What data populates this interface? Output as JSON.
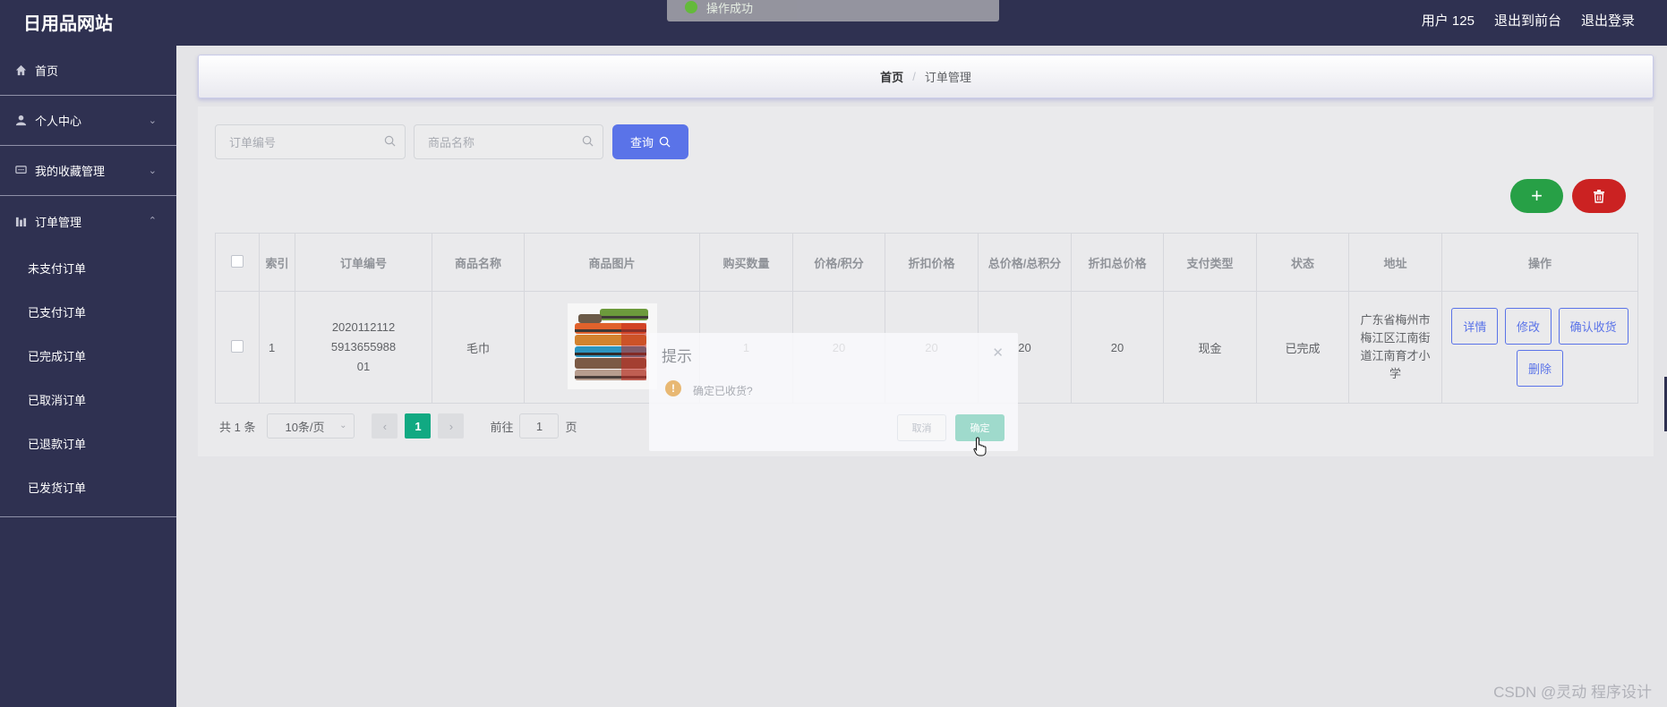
{
  "header": {
    "brand": "日用品网站",
    "user": "用户 125",
    "front_link": "退出到前台",
    "logout_link": "退出登录",
    "toast": "操作成功"
  },
  "sidebar": {
    "items": [
      {
        "label": "首页",
        "icon": "home-icon"
      },
      {
        "label": "个人中心",
        "icon": "user-icon"
      },
      {
        "label": "我的收藏管理",
        "icon": "chat-icon"
      },
      {
        "label": "订单管理",
        "icon": "chart-icon"
      }
    ],
    "subitems": [
      "未支付订单",
      "已支付订单",
      "已完成订单",
      "已取消订单",
      "已退款订单",
      "已发货订单"
    ]
  },
  "breadcrumb": {
    "home": "首页",
    "separator": "/",
    "current": "订单管理"
  },
  "search": {
    "order_no_placeholder": "订单编号",
    "product_placeholder": "商品名称",
    "query_label": "查询"
  },
  "table": {
    "headers": [
      "索引",
      "订单编号",
      "商品名称",
      "商品图片",
      "购买数量",
      "价格/积分",
      "折扣价格",
      "总价格/总积分",
      "折扣总价格",
      "支付类型",
      "状态",
      "地址",
      "操作"
    ],
    "rows": [
      {
        "index": "1",
        "order_no": "20201121125913655988 01",
        "order_no_lines": [
          "2020112112",
          "5913655988",
          "01"
        ],
        "product": "毛巾",
        "quantity": "1",
        "price": "20",
        "discount_price": "20",
        "total": "20",
        "discount_total": "20",
        "pay_type": "现金",
        "status": "已完成",
        "address_lines": [
          "广东省梅州市",
          "梅江区江南街",
          "道江南育才小",
          "学"
        ]
      }
    ],
    "actions": {
      "detail": "详情",
      "edit": "修改",
      "confirm": "确认收货",
      "delete": "删除"
    }
  },
  "pagination": {
    "total": "共 1 条",
    "page_size": "10条/页",
    "current_page": "1",
    "goto_prefix": "前往",
    "goto_value": "1",
    "goto_suffix": "页"
  },
  "dialog": {
    "title": "提示",
    "message": "确定已收货?",
    "cancel": "取消",
    "confirm": "确定"
  },
  "watermark": "CSDN @灵动 程序设计",
  "colors": {
    "nav_bg": "#2f3151",
    "primary": "#5a73e8",
    "add_button": "#27a046",
    "delete_button": "#cb2222",
    "pager_active": "#11a982"
  }
}
